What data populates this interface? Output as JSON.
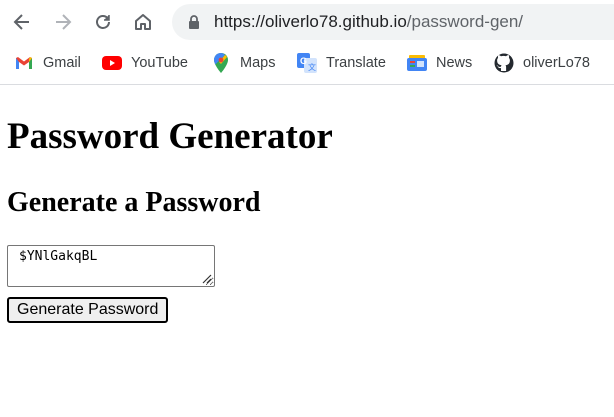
{
  "browser": {
    "url_host": "https://oliverlo78.github.io",
    "url_path": "/password-gen/"
  },
  "bookmarks": [
    {
      "label": "Gmail",
      "icon": "gmail-icon"
    },
    {
      "label": "YouTube",
      "icon": "youtube-icon"
    },
    {
      "label": "Maps",
      "icon": "maps-icon"
    },
    {
      "label": "Translate",
      "icon": "translate-icon"
    },
    {
      "label": "News",
      "icon": "news-icon"
    },
    {
      "label": "oliverLo78",
      "icon": "github-icon"
    }
  ],
  "page": {
    "title": "Password Generator",
    "subtitle": "Generate a Password",
    "password_value": "$YNlGakqBL",
    "generate_button": "Generate Password"
  },
  "colors": {
    "toolbar_icon": "#5f6368",
    "omnibox_bg": "#f1f3f4",
    "youtube_red": "#ff0000"
  }
}
